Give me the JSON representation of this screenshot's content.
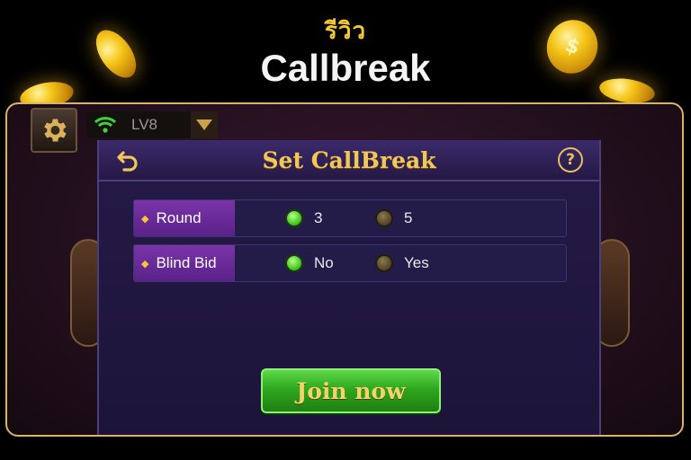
{
  "banner": {
    "subtitle": "รีวิว",
    "title": "Callbreak"
  },
  "toolbar": {
    "level": "LV8"
  },
  "dialog": {
    "title": "Set CallBreak",
    "help": "?",
    "options": [
      {
        "label": "Round",
        "choices": [
          {
            "text": "3",
            "selected": true
          },
          {
            "text": "5",
            "selected": false
          }
        ]
      },
      {
        "label": "Blind Bid",
        "choices": [
          {
            "text": "No",
            "selected": true
          },
          {
            "text": "Yes",
            "selected": false
          }
        ]
      }
    ],
    "join_label": "Join now"
  },
  "colors": {
    "accent_gold": "#f1c75a",
    "label_purple": "#7a34a8",
    "join_green": "#2ea81e",
    "radio_on": "#4fcf2a"
  }
}
